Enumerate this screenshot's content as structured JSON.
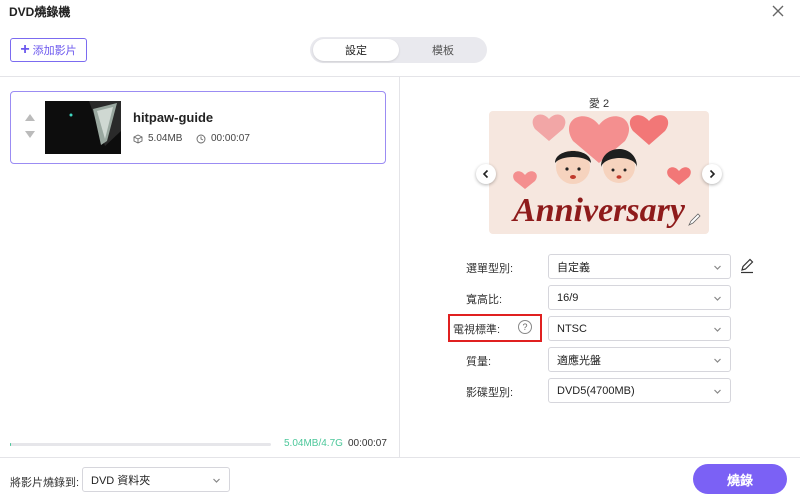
{
  "window": {
    "title": "DVD燒錄機"
  },
  "toolbar": {
    "add_video_label": "添加影片"
  },
  "tabs": [
    {
      "label": "設定",
      "active": true
    },
    {
      "label": "模板",
      "active": false
    }
  ],
  "video_list": [
    {
      "name": "hitpaw-guide",
      "size": "5.04MB",
      "duration": "00:00:07"
    }
  ],
  "progress": {
    "capacity_text": "5.04MB/4.7G",
    "total_duration": "00:00:07",
    "fill_percent": 0.5
  },
  "template": {
    "name": "愛 2",
    "banner_text": "Anniversary"
  },
  "settings": {
    "menu_type": {
      "label": "選單型別:",
      "value": "自定義"
    },
    "aspect_ratio": {
      "label": "寬高比:",
      "value": "16/9"
    },
    "tv_standard": {
      "label": "電視標準:",
      "value": "NTSC"
    },
    "quality": {
      "label": "質量:",
      "value": "適應光盤"
    },
    "disc_type": {
      "label": "影碟型別:",
      "value": "DVD5(4700MB)"
    }
  },
  "footer": {
    "burn_to_label": "將影片燒錄到:",
    "burn_target": "DVD 資料夾",
    "burn_button": "燒錄"
  },
  "colors": {
    "accent": "#7b61f5",
    "progress": "#4cc79a",
    "highlight": "#e02020"
  }
}
